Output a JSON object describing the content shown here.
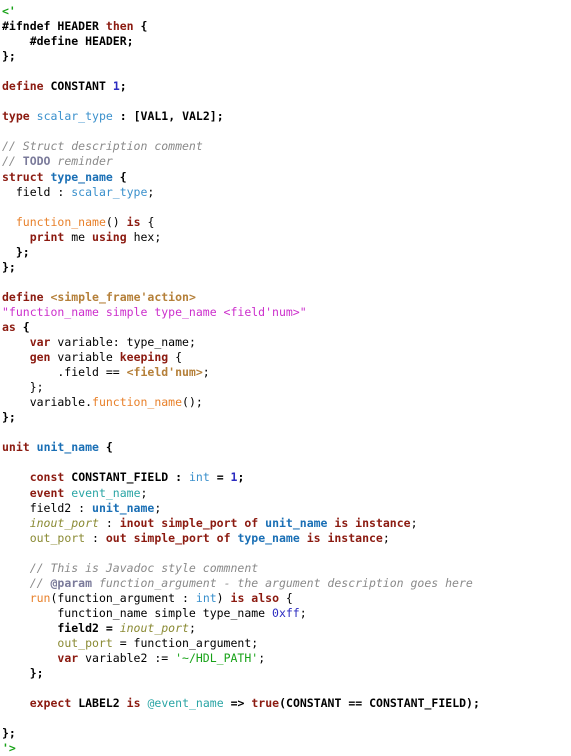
{
  "document": {
    "language": "e (Specman)",
    "background": "#ffffff",
    "palette": {
      "plain": "#000000",
      "keyword": "#8b1a10",
      "type": "#3a90cc",
      "type_bold": "#1a6fb5",
      "number": "#2b2bc0",
      "comment": "#8a8a8a",
      "doc_tag": "#7a7a9a",
      "function": "#e8802a",
      "macro": "#17a217",
      "string": "#17a217",
      "magenta": "#cc2fcc",
      "tan": "#b5803a",
      "olive": "#8a8a33",
      "teal": "#2aa5a5"
    }
  },
  "lines": [
    {
      "id": "l1",
      "tokens": [
        {
          "t": "<'",
          "c": "t-macro"
        }
      ]
    },
    {
      "id": "l2",
      "tokens": [
        {
          "t": "#ifndef",
          "c": "t-ident-b"
        },
        {
          "t": " ",
          "c": "t-plain"
        },
        {
          "t": "HEADER",
          "c": "t-ident-b"
        },
        {
          "t": " ",
          "c": "t-plain"
        },
        {
          "t": "then",
          "c": "t-kw"
        },
        {
          "t": " ",
          "c": "t-plain"
        },
        {
          "t": "{",
          "c": "t-ident-b"
        }
      ]
    },
    {
      "id": "l3",
      "tokens": [
        {
          "t": "    ",
          "c": "t-plain"
        },
        {
          "t": "#define",
          "c": "t-ident-b"
        },
        {
          "t": " ",
          "c": "t-plain"
        },
        {
          "t": "HEADER",
          "c": "t-ident-b"
        },
        {
          "t": ";",
          "c": "t-ident-b"
        }
      ]
    },
    {
      "id": "l4",
      "tokens": [
        {
          "t": "};",
          "c": "t-ident-b"
        }
      ]
    },
    {
      "id": "l5",
      "tokens": []
    },
    {
      "id": "l6",
      "tokens": [
        {
          "t": "define",
          "c": "t-kw"
        },
        {
          "t": " ",
          "c": "t-plain"
        },
        {
          "t": "CONSTANT",
          "c": "t-ident-b"
        },
        {
          "t": " ",
          "c": "t-plain"
        },
        {
          "t": "1",
          "c": "t-num-b"
        },
        {
          "t": ";",
          "c": "t-ident-b"
        }
      ]
    },
    {
      "id": "l7",
      "tokens": []
    },
    {
      "id": "l8",
      "tokens": [
        {
          "t": "type",
          "c": "t-kw"
        },
        {
          "t": " ",
          "c": "t-plain"
        },
        {
          "t": "scalar_type",
          "c": "t-type"
        },
        {
          "t": " : [",
          "c": "t-ident-b"
        },
        {
          "t": "VAL1",
          "c": "t-ident-b"
        },
        {
          "t": ", ",
          "c": "t-ident-b"
        },
        {
          "t": "VAL2",
          "c": "t-ident-b"
        },
        {
          "t": "];",
          "c": "t-ident-b"
        }
      ]
    },
    {
      "id": "l9",
      "tokens": []
    },
    {
      "id": "l10",
      "tokens": [
        {
          "t": "// Struct description comment",
          "c": "t-comment"
        }
      ]
    },
    {
      "id": "l11",
      "tokens": [
        {
          "t": "// ",
          "c": "t-comment"
        },
        {
          "t": "TODO",
          "c": "t-tag"
        },
        {
          "t": " reminder",
          "c": "t-comment"
        }
      ]
    },
    {
      "id": "l12",
      "tokens": [
        {
          "t": "struct",
          "c": "t-kw"
        },
        {
          "t": " ",
          "c": "t-plain"
        },
        {
          "t": "type_name",
          "c": "t-type-b"
        },
        {
          "t": " {",
          "c": "t-ident-b"
        }
      ]
    },
    {
      "id": "l13",
      "tokens": [
        {
          "t": "  field : ",
          "c": "t-plain"
        },
        {
          "t": "scalar_type",
          "c": "t-type"
        },
        {
          "t": ";",
          "c": "t-plain"
        }
      ]
    },
    {
      "id": "l14",
      "tokens": []
    },
    {
      "id": "l15",
      "tokens": [
        {
          "t": "  ",
          "c": "t-plain"
        },
        {
          "t": "function_name",
          "c": "t-func"
        },
        {
          "t": "() ",
          "c": "t-plain"
        },
        {
          "t": "is",
          "c": "t-kw"
        },
        {
          "t": " {",
          "c": "t-plain"
        }
      ]
    },
    {
      "id": "l16",
      "tokens": [
        {
          "t": "    ",
          "c": "t-plain"
        },
        {
          "t": "print",
          "c": "t-kw"
        },
        {
          "t": " me ",
          "c": "t-plain"
        },
        {
          "t": "using",
          "c": "t-kw"
        },
        {
          "t": " hex;",
          "c": "t-plain"
        }
      ]
    },
    {
      "id": "l17",
      "tokens": [
        {
          "t": "  };",
          "c": "t-ident-b"
        }
      ]
    },
    {
      "id": "l18",
      "tokens": [
        {
          "t": "};",
          "c": "t-ident-b"
        }
      ]
    },
    {
      "id": "l19",
      "tokens": []
    },
    {
      "id": "l20",
      "tokens": [
        {
          "t": "define",
          "c": "t-kw"
        },
        {
          "t": " ",
          "c": "t-plain"
        },
        {
          "t": "<simple_frame'action>",
          "c": "t-tan"
        }
      ]
    },
    {
      "id": "l21",
      "tokens": [
        {
          "t": "\"function_name simple type_name <field'num>\"",
          "c": "t-magenta"
        }
      ]
    },
    {
      "id": "l22",
      "tokens": [
        {
          "t": "as",
          "c": "t-kw"
        },
        {
          "t": " {",
          "c": "t-ident-b"
        }
      ]
    },
    {
      "id": "l23",
      "tokens": [
        {
          "t": "    ",
          "c": "t-plain"
        },
        {
          "t": "var",
          "c": "t-kw"
        },
        {
          "t": " variable: type_name;",
          "c": "t-plain"
        }
      ]
    },
    {
      "id": "l24",
      "tokens": [
        {
          "t": "    ",
          "c": "t-plain"
        },
        {
          "t": "gen",
          "c": "t-kw"
        },
        {
          "t": " variable ",
          "c": "t-plain"
        },
        {
          "t": "keeping",
          "c": "t-kw"
        },
        {
          "t": " {",
          "c": "t-plain"
        }
      ]
    },
    {
      "id": "l25",
      "tokens": [
        {
          "t": "        .field == ",
          "c": "t-plain"
        },
        {
          "t": "<field'num>",
          "c": "t-tan"
        },
        {
          "t": ";",
          "c": "t-plain"
        }
      ]
    },
    {
      "id": "l26",
      "tokens": [
        {
          "t": "    };",
          "c": "t-plain"
        }
      ]
    },
    {
      "id": "l27",
      "tokens": [
        {
          "t": "    variable.",
          "c": "t-plain"
        },
        {
          "t": "function_name",
          "c": "t-func"
        },
        {
          "t": "();",
          "c": "t-plain"
        }
      ]
    },
    {
      "id": "l28",
      "tokens": [
        {
          "t": "};",
          "c": "t-ident-b"
        }
      ]
    },
    {
      "id": "l29",
      "tokens": []
    },
    {
      "id": "l30",
      "tokens": [
        {
          "t": "unit",
          "c": "t-kw"
        },
        {
          "t": " ",
          "c": "t-plain"
        },
        {
          "t": "unit_name",
          "c": "t-type-b"
        },
        {
          "t": " {",
          "c": "t-ident-b"
        }
      ]
    },
    {
      "id": "l31",
      "tokens": []
    },
    {
      "id": "l32",
      "tokens": [
        {
          "t": "    ",
          "c": "t-plain"
        },
        {
          "t": "const",
          "c": "t-kw"
        },
        {
          "t": " ",
          "c": "t-plain"
        },
        {
          "t": "CONSTANT_FIELD",
          "c": "t-ident-b"
        },
        {
          "t": " : ",
          "c": "t-ident-b"
        },
        {
          "t": "int",
          "c": "t-type"
        },
        {
          "t": " = ",
          "c": "t-ident-b"
        },
        {
          "t": "1",
          "c": "t-num-b"
        },
        {
          "t": ";",
          "c": "t-ident-b"
        }
      ]
    },
    {
      "id": "l33",
      "tokens": [
        {
          "t": "    ",
          "c": "t-plain"
        },
        {
          "t": "event",
          "c": "t-kw"
        },
        {
          "t": " ",
          "c": "t-plain"
        },
        {
          "t": "event_name",
          "c": "t-teal"
        },
        {
          "t": ";",
          "c": "t-plain"
        }
      ]
    },
    {
      "id": "l34",
      "tokens": [
        {
          "t": "    field2 : ",
          "c": "t-plain"
        },
        {
          "t": "unit_name",
          "c": "t-type-b"
        },
        {
          "t": ";",
          "c": "t-plain"
        }
      ]
    },
    {
      "id": "l35",
      "tokens": [
        {
          "t": "    ",
          "c": "t-plain"
        },
        {
          "t": "inout_port",
          "c": "t-olive-i"
        },
        {
          "t": " : ",
          "c": "t-plain"
        },
        {
          "t": "inout simple_port of",
          "c": "t-kw"
        },
        {
          "t": " ",
          "c": "t-plain"
        },
        {
          "t": "unit_name",
          "c": "t-type-b"
        },
        {
          "t": " ",
          "c": "t-plain"
        },
        {
          "t": "is instance",
          "c": "t-kw"
        },
        {
          "t": ";",
          "c": "t-plain"
        }
      ]
    },
    {
      "id": "l36",
      "tokens": [
        {
          "t": "    ",
          "c": "t-plain"
        },
        {
          "t": "out_port",
          "c": "t-olive"
        },
        {
          "t": " : ",
          "c": "t-plain"
        },
        {
          "t": "out simple_port of",
          "c": "t-kw"
        },
        {
          "t": " ",
          "c": "t-plain"
        },
        {
          "t": "type_name",
          "c": "t-type-b"
        },
        {
          "t": " ",
          "c": "t-plain"
        },
        {
          "t": "is instance",
          "c": "t-kw"
        },
        {
          "t": ";",
          "c": "t-plain"
        }
      ]
    },
    {
      "id": "l37",
      "tokens": []
    },
    {
      "id": "l38",
      "tokens": [
        {
          "t": "    // This is Javadoc style commnent",
          "c": "t-comment"
        }
      ]
    },
    {
      "id": "l39",
      "tokens": [
        {
          "t": "    // ",
          "c": "t-comment"
        },
        {
          "t": "@param",
          "c": "t-tag"
        },
        {
          "t": " function_argument - the argument description goes here",
          "c": "t-comment"
        }
      ]
    },
    {
      "id": "l40",
      "tokens": [
        {
          "t": "    ",
          "c": "t-plain"
        },
        {
          "t": "run",
          "c": "t-func"
        },
        {
          "t": "(function_argument : ",
          "c": "t-plain"
        },
        {
          "t": "int",
          "c": "t-type"
        },
        {
          "t": ") ",
          "c": "t-plain"
        },
        {
          "t": "is also",
          "c": "t-kw"
        },
        {
          "t": " {",
          "c": "t-plain"
        }
      ]
    },
    {
      "id": "l41",
      "tokens": [
        {
          "t": "        function_name simple type_name ",
          "c": "t-plain"
        },
        {
          "t": "0xff",
          "c": "t-num"
        },
        {
          "t": ";",
          "c": "t-plain"
        }
      ]
    },
    {
      "id": "l42",
      "tokens": [
        {
          "t": "        field2 = ",
          "c": "t-ident-b"
        },
        {
          "t": "inout_port",
          "c": "t-olive-i"
        },
        {
          "t": ";",
          "c": "t-plain"
        }
      ]
    },
    {
      "id": "l43",
      "tokens": [
        {
          "t": "        ",
          "c": "t-plain"
        },
        {
          "t": "out_port",
          "c": "t-olive"
        },
        {
          "t": " = function_argument;",
          "c": "t-plain"
        }
      ]
    },
    {
      "id": "l44",
      "tokens": [
        {
          "t": "        ",
          "c": "t-plain"
        },
        {
          "t": "var",
          "c": "t-kw"
        },
        {
          "t": " variable2 := ",
          "c": "t-plain"
        },
        {
          "t": "'~/HDL_PATH'",
          "c": "t-str"
        },
        {
          "t": ";",
          "c": "t-plain"
        }
      ]
    },
    {
      "id": "l45",
      "tokens": [
        {
          "t": "    };",
          "c": "t-ident-b"
        }
      ]
    },
    {
      "id": "l46",
      "tokens": []
    },
    {
      "id": "l47",
      "tokens": [
        {
          "t": "    ",
          "c": "t-plain"
        },
        {
          "t": "expect",
          "c": "t-kw"
        },
        {
          "t": " ",
          "c": "t-plain"
        },
        {
          "t": "LABEL2",
          "c": "t-ident-b"
        },
        {
          "t": " ",
          "c": "t-plain"
        },
        {
          "t": "is",
          "c": "t-kw"
        },
        {
          "t": " ",
          "c": "t-plain"
        },
        {
          "t": "@event_name",
          "c": "t-teal"
        },
        {
          "t": " ",
          "c": "t-plain"
        },
        {
          "t": "=>",
          "c": "t-ident-b"
        },
        {
          "t": " ",
          "c": "t-plain"
        },
        {
          "t": "true",
          "c": "t-kw"
        },
        {
          "t": "(",
          "c": "t-ident-b"
        },
        {
          "t": "CONSTANT",
          "c": "t-ident-b"
        },
        {
          "t": " == ",
          "c": "t-ident-b"
        },
        {
          "t": "CONSTANT_FIELD",
          "c": "t-ident-b"
        },
        {
          "t": ");",
          "c": "t-ident-b"
        }
      ]
    },
    {
      "id": "l48",
      "tokens": []
    },
    {
      "id": "l49",
      "tokens": [
        {
          "t": "};",
          "c": "t-ident-b"
        }
      ]
    },
    {
      "id": "l50",
      "tokens": [
        {
          "t": "'>",
          "c": "t-macro"
        }
      ]
    }
  ]
}
